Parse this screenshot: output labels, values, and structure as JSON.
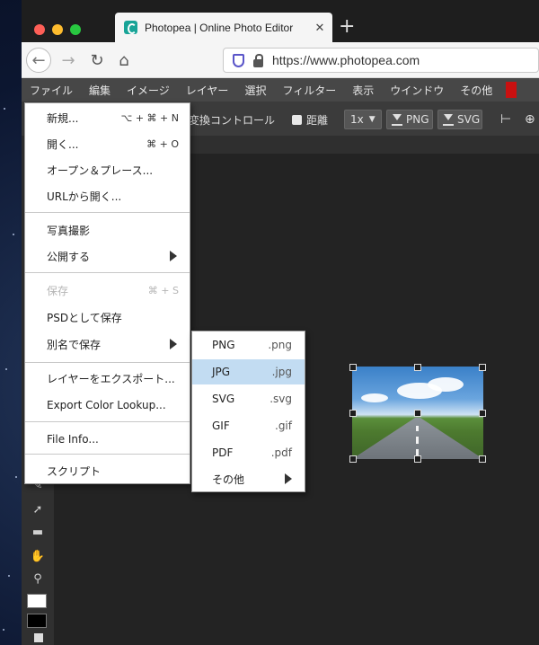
{
  "browser": {
    "tab_title": "Photopea | Online Photo Editor",
    "tab_close": "✕",
    "new_tab": "+",
    "url": "https://www.photopea.com",
    "traffic_colors": [
      "#fe5f57",
      "#febc2e",
      "#28c840"
    ]
  },
  "menubar": {
    "items": [
      "ファイル",
      "編集",
      "イメージ",
      "レイヤー",
      "選択",
      "フィルター",
      "表示",
      "ウインドウ",
      "その他"
    ]
  },
  "toolbar": {
    "transform_controls": "変換コントロール",
    "distance": "距離",
    "scale": "1x",
    "png": "PNG",
    "svg": "SVG"
  },
  "file_menu": {
    "items": [
      {
        "label": "新規...",
        "shortcut": "⌥ + ⌘ + N"
      },
      {
        "label": "開く...",
        "shortcut": "⌘ + O"
      },
      {
        "label": "オープン＆プレース...",
        "shortcut": ""
      },
      {
        "label": "URLから開く...",
        "shortcut": ""
      },
      {
        "label": "写真撮影",
        "shortcut": ""
      },
      {
        "label": "公開する",
        "shortcut": ""
      },
      {
        "label": "保存",
        "shortcut": "⌘ + S"
      },
      {
        "label": "PSDとして保存",
        "shortcut": ""
      },
      {
        "label": "別名で保存",
        "shortcut": ""
      },
      {
        "label": "レイヤーをエクスポート...",
        "shortcut": ""
      },
      {
        "label": "Export Color Lookup...",
        "shortcut": ""
      },
      {
        "label": "File Info...",
        "shortcut": ""
      },
      {
        "label": "スクリプト",
        "shortcut": ""
      }
    ]
  },
  "save_as_submenu": {
    "items": [
      {
        "label": "PNG",
        "ext": ".png"
      },
      {
        "label": "JPG",
        "ext": ".jpg"
      },
      {
        "label": "SVG",
        "ext": ".svg"
      },
      {
        "label": "GIF",
        "ext": ".gif"
      },
      {
        "label": "PDF",
        "ext": ".pdf"
      },
      {
        "label": "その他",
        "ext": ""
      }
    ],
    "highlighted": "JPG"
  },
  "icons": [
    "back-arrow-icon",
    "forward-arrow-icon",
    "reload-icon",
    "home-icon",
    "shield-icon",
    "lock-icon",
    "download-icon",
    "submenu-arrow-icon",
    "hand-icon",
    "zoom-icon",
    "rectangle-icon",
    "select-icon"
  ]
}
